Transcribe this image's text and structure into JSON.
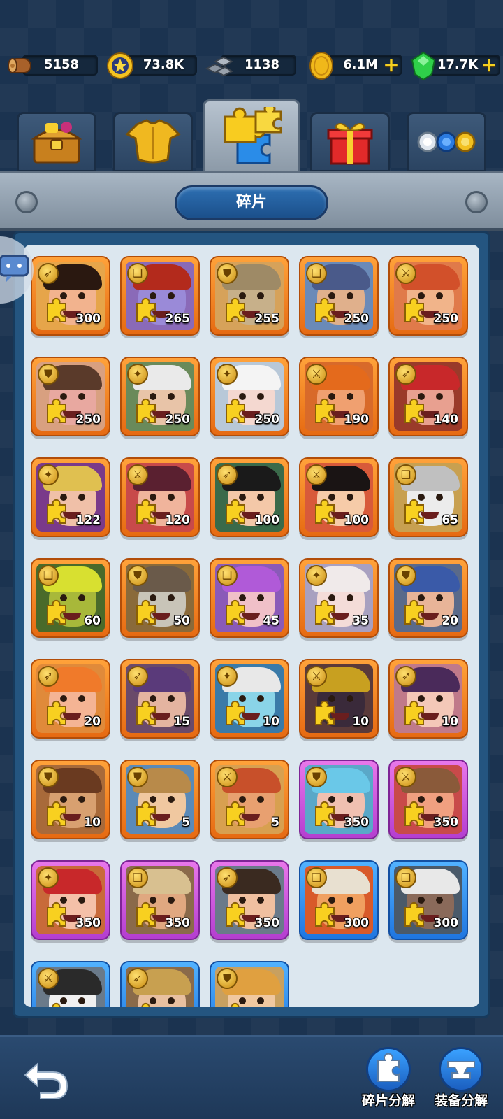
{
  "resources": {
    "wood": "5158",
    "stars": "73.8K",
    "iron": "1138",
    "gold": "6.1M",
    "gems": "17.7K",
    "plus_symbol": "+"
  },
  "tabs": [
    {
      "icon": "treasure-chest-icon",
      "active": false
    },
    {
      "icon": "armor-icon",
      "active": false
    },
    {
      "icon": "puzzle-pieces-icon",
      "active": true
    },
    {
      "icon": "gift-box-icon",
      "active": false
    },
    {
      "icon": "orbs-icon",
      "active": false
    }
  ],
  "header": {
    "title": "碎片"
  },
  "fragments": [
    {
      "count": "300",
      "rarity": "orange",
      "role": "bow",
      "skin": "#f2b38e",
      "hair": "#2a1810",
      "bg": "#e6a54a"
    },
    {
      "count": "265",
      "rarity": "orange",
      "role": "book",
      "skin": "#9a8ad8",
      "hair": "#b32a1c",
      "bg": "#8a6ab8"
    },
    {
      "count": "255",
      "rarity": "orange",
      "role": "shield",
      "skin": "#c7b08a",
      "hair": "#9e8a66",
      "bg": "#d6a25a"
    },
    {
      "count": "250",
      "rarity": "orange",
      "role": "book",
      "skin": "#e0b08c",
      "hair": "#4a5a8a",
      "bg": "#6a8ab8"
    },
    {
      "count": "250",
      "rarity": "orange",
      "role": "sword",
      "skin": "#f1b48a",
      "hair": "#d2502a",
      "bg": "#e07a4a"
    },
    {
      "count": "250",
      "rarity": "orange",
      "role": "shield",
      "skin": "#e8a8a0",
      "hair": "#5a3a2a",
      "bg": "#d8a080"
    },
    {
      "count": "250",
      "rarity": "orange",
      "role": "staff",
      "skin": "#e8c4a8",
      "hair": "#eaeaea",
      "bg": "#6a8a5a"
    },
    {
      "count": "250",
      "rarity": "orange",
      "role": "staff",
      "skin": "#f4d8d0",
      "hair": "#f4f4f4",
      "bg": "#b8c8d8"
    },
    {
      "count": "190",
      "rarity": "orange",
      "role": "sword",
      "skin": "#f0a070",
      "hair": "#e46a1c",
      "bg": "#d86a2a"
    },
    {
      "count": "140",
      "rarity": "orange",
      "role": "bow",
      "skin": "#e8a090",
      "hair": "#c8282a",
      "bg": "#9a3a2a"
    },
    {
      "count": "122",
      "rarity": "orange",
      "role": "staff",
      "skin": "#f0c0a8",
      "hair": "#e0c050",
      "bg": "#7a3a8a"
    },
    {
      "count": "120",
      "rarity": "orange",
      "role": "sword",
      "skin": "#f0b49c",
      "hair": "#5a2030",
      "bg": "#c84a4a"
    },
    {
      "count": "100",
      "rarity": "orange",
      "role": "bow",
      "skin": "#f4c8a8",
      "hair": "#1a1a1a",
      "bg": "#3a6a4a"
    },
    {
      "count": "100",
      "rarity": "orange",
      "role": "sword",
      "skin": "#f6cba8",
      "hair": "#1a1414",
      "bg": "#d85a3a"
    },
    {
      "count": "65",
      "rarity": "orange",
      "role": "book",
      "skin": "#ececec",
      "hair": "#c0c0c0",
      "bg": "#c8a050"
    },
    {
      "count": "60",
      "rarity": "orange",
      "role": "book",
      "skin": "#a8b83a",
      "hair": "#d8e030",
      "bg": "#4a6a2a"
    },
    {
      "count": "50",
      "rarity": "orange",
      "role": "shield",
      "skin": "#c8c4b8",
      "hair": "#6a5a4a",
      "bg": "#8a6a3a"
    },
    {
      "count": "45",
      "rarity": "orange",
      "role": "book",
      "skin": "#f0c0c8",
      "hair": "#b05ad8",
      "bg": "#8a5ab8"
    },
    {
      "count": "35",
      "rarity": "orange",
      "role": "staff",
      "skin": "#f4dcd8",
      "hair": "#f0eaea",
      "bg": "#a8a0c0"
    },
    {
      "count": "20",
      "rarity": "orange",
      "role": "shield",
      "skin": "#e8b498",
      "hair": "#3a5aa8",
      "bg": "#5a6a8a"
    },
    {
      "count": "20",
      "rarity": "orange",
      "role": "bow",
      "skin": "#f4b494",
      "hair": "#f07a2a",
      "bg": "#e08a3a"
    },
    {
      "count": "15",
      "rarity": "orange",
      "role": "bow",
      "skin": "#e4b4a0",
      "hair": "#5a3a7a",
      "bg": "#6a4a6a"
    },
    {
      "count": "10",
      "rarity": "orange",
      "role": "staff",
      "skin": "#8ad4e8",
      "hair": "#e8e8e8",
      "bg": "#3a7aa8"
    },
    {
      "count": "10",
      "rarity": "orange",
      "role": "sword",
      "skin": "#3a2a3a",
      "hair": "#c8a020",
      "bg": "#5a3a3a"
    },
    {
      "count": "10",
      "rarity": "orange",
      "role": "bow",
      "skin": "#f4c8b8",
      "hair": "#4a2a5a",
      "bg": "#c07a8a"
    },
    {
      "count": "10",
      "rarity": "orange",
      "role": "shield",
      "skin": "#d8a070",
      "hair": "#6a3a20",
      "bg": "#a86a3a"
    },
    {
      "count": "5",
      "rarity": "orange",
      "role": "shield",
      "skin": "#f0c8a0",
      "hair": "#b88a4a",
      "bg": "#5a8ab8"
    },
    {
      "count": "5",
      "rarity": "orange",
      "role": "sword",
      "skin": "#e8a070",
      "hair": "#c8502a",
      "bg": "#d8a050"
    },
    {
      "count": "350",
      "rarity": "purple",
      "role": "shield",
      "skin": "#f0c0b0",
      "hair": "#6ac8e8",
      "bg": "#5aa8c8"
    },
    {
      "count": "350",
      "rarity": "purple",
      "role": "sword",
      "skin": "#f0a080",
      "hair": "#8a5a3a",
      "bg": "#c84a4a"
    },
    {
      "count": "350",
      "rarity": "purple",
      "role": "staff",
      "skin": "#f4c0a8",
      "hair": "#c8282a",
      "bg": "#c86a3a"
    },
    {
      "count": "350",
      "rarity": "purple",
      "role": "book",
      "skin": "#e0a880",
      "hair": "#d8c090",
      "bg": "#8a6a4a"
    },
    {
      "count": "350",
      "rarity": "purple",
      "role": "bow",
      "skin": "#f0c0a0",
      "hair": "#3a2a20",
      "bg": "#6a7a8a"
    },
    {
      "count": "300",
      "rarity": "blue",
      "role": "book",
      "skin": "#f0a060",
      "hair": "#e8e0d0",
      "bg": "#d85a2a"
    },
    {
      "count": "300",
      "rarity": "blue",
      "role": "book",
      "skin": "#8a6a5a",
      "hair": "#e8e8e8",
      "bg": "#4a5a6a"
    },
    {
      "count": "",
      "rarity": "blue",
      "role": "sword",
      "skin": "#f0f0f0",
      "hair": "#2a2a2a",
      "bg": "#6a7a8a"
    },
    {
      "count": "",
      "rarity": "blue",
      "role": "bow",
      "skin": "#e8c0a0",
      "hair": "#c8a050",
      "bg": "#8a6a4a"
    },
    {
      "count": "",
      "rarity": "blue",
      "role": "shield",
      "skin": "#f0c8a0",
      "hair": "#e0a040",
      "bg": "#c8a060"
    }
  ],
  "bottom": {
    "shard_decompose_label": "碎片分解",
    "equip_decompose_label": "装备分解"
  },
  "colors": {
    "accent_gold": "#f5d020",
    "orange_frame": "#ff8a1c",
    "purple_frame": "#d35ae0",
    "blue_frame": "#2a8cf0"
  }
}
